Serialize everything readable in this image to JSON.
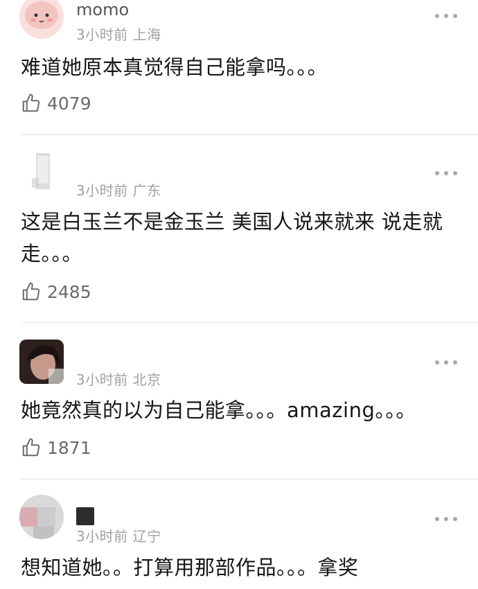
{
  "comments": [
    {
      "username": "momo",
      "time": "3小时前",
      "location": "上海",
      "text": "难道她原本真觉得自己能拿吗。。。",
      "likes": "4079",
      "avatar": "cartoon-avatar"
    },
    {
      "username": "",
      "time": "3小时前",
      "location": "广东",
      "text": "这是白玉兰不是金玉兰 美国人说来就来 说走就走。。。",
      "likes": "2485",
      "avatar": "blurred-avatar"
    },
    {
      "username": "",
      "time": "3小时前",
      "location": "北京",
      "text": "她竟然真的以为自己能拿。。。amazing。。。",
      "likes": "1871",
      "avatar": "photo-avatar"
    },
    {
      "username": "",
      "time": "3小时前",
      "location": "辽宁",
      "text": "想知道她。。打算用那部作品。。。拿奖",
      "likes": "",
      "avatar": "blurred-avatar"
    }
  ],
  "colors": {
    "text": "#161616",
    "meta": "#a0a0a0",
    "divider": "#e6e6e6"
  },
  "icons": {
    "more": "more-dots-icon",
    "like": "thumbs-up-icon"
  }
}
